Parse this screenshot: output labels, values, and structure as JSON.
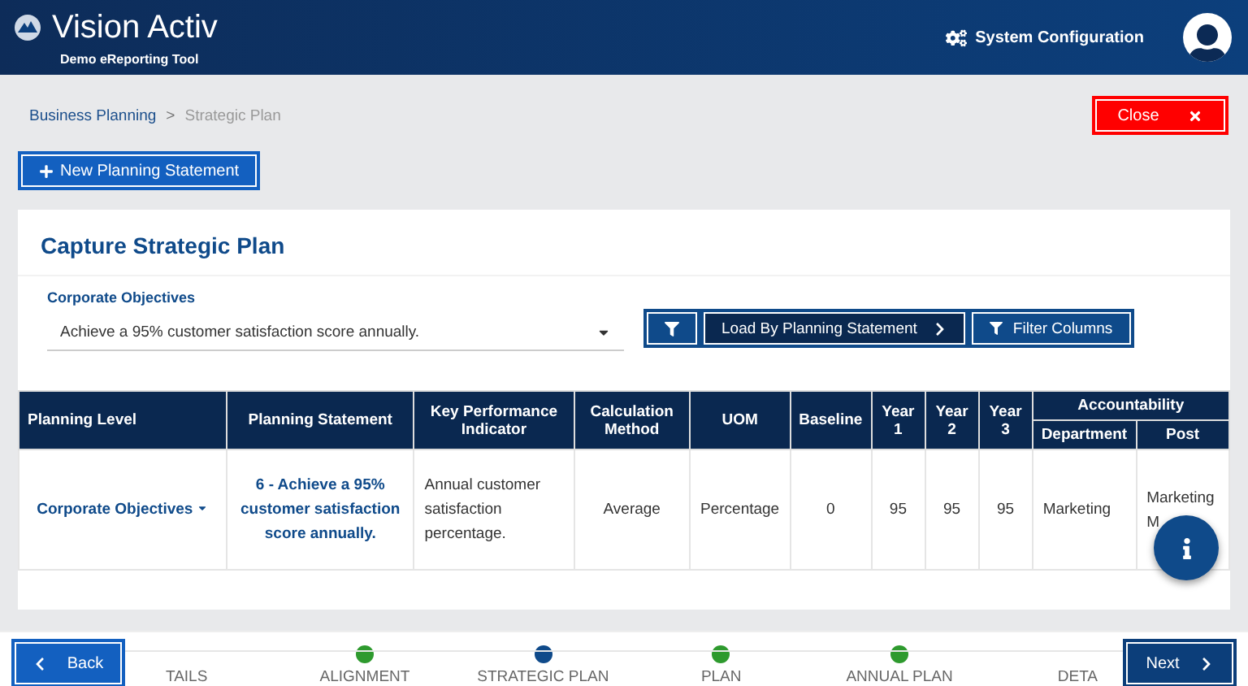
{
  "header": {
    "brand": "Vision Activ",
    "subtitle": "Demo eReporting Tool",
    "config_link": "System Configuration"
  },
  "breadcrumb": [
    {
      "label": "Business Planning",
      "selected": false
    },
    {
      "label": "Strategic Plan",
      "selected": true
    }
  ],
  "breadcrumb_separator": ">",
  "close_button": "Close",
  "new_button": "New Planning Statement",
  "card": {
    "title": "Capture Strategic Plan",
    "field_label": "Corporate Objectives",
    "field_value": "Achieve a 95% customer satisfaction score annually.",
    "load_button": "Load By Planning Statement",
    "filter_button": "Filter Columns"
  },
  "table": {
    "columns": [
      "Planning Level",
      "Planning Statement",
      "Key Performance Indicator",
      "Calculation Method",
      "UOM",
      "Baseline",
      "Year 1",
      "Year 2",
      "Year 3"
    ],
    "group_header": "Accountability",
    "group_columns": [
      "Department",
      "Post"
    ],
    "rows": [
      {
        "cells": [
          "Corporate Objectives",
          "6 - Achieve a 95% customer satisfaction score annually.",
          "Annual customer satisfaction percentage.",
          "Average",
          "Percentage",
          "0",
          "95",
          "95",
          "95",
          "Marketing",
          "Marketing M"
        ]
      }
    ]
  },
  "footer": {
    "back_button": "Back",
    "next_button": "Next",
    "steps": [
      {
        "label": "TAILS",
        "dot": false
      },
      {
        "label": "ALIGNMENT",
        "selected": false,
        "dot": true
      },
      {
        "label": "STRATEGIC PLAN",
        "selected": true,
        "dot": true
      },
      {
        "label": "PLAN",
        "selected": false,
        "dot": true
      },
      {
        "label": "ANNUAL PLAN",
        "selected": false,
        "dot": true
      },
      {
        "label": "DETA",
        "dot": false
      }
    ]
  }
}
